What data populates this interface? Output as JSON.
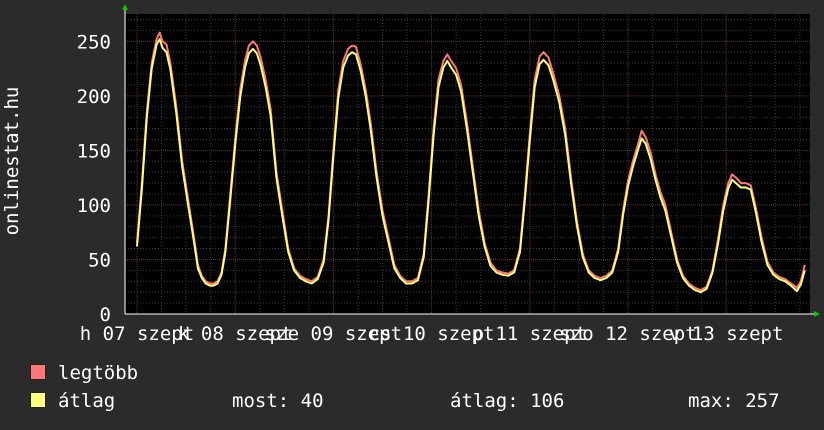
{
  "chart_data": {
    "type": "line",
    "ylabel": "onlinestat.hu",
    "ylim": [
      0,
      275
    ],
    "yticks": [
      0,
      50,
      100,
      150,
      200,
      250
    ],
    "xlim": [
      0,
      7.7
    ],
    "xticks": [
      {
        "x": 0.0,
        "label": "h 07 szept"
      },
      {
        "x": 1.0,
        "label": "k 08 szept"
      },
      {
        "x": 2.0,
        "label": "sze 09 szept"
      },
      {
        "x": 3.0,
        "label": "cs 10 szept"
      },
      {
        "x": 4.0,
        "label": "p 11 szept"
      },
      {
        "x": 5.0,
        "label": "szo 12 szept"
      },
      {
        "x": 6.0,
        "label": "v 13 szept"
      }
    ],
    "series": [
      {
        "name": "legtöbb",
        "color": "#ff7777",
        "points": [
          [
            0.0,
            65
          ],
          [
            0.05,
            120
          ],
          [
            0.1,
            185
          ],
          [
            0.15,
            230
          ],
          [
            0.2,
            252
          ],
          [
            0.23,
            258
          ],
          [
            0.26,
            250
          ],
          [
            0.3,
            247
          ],
          [
            0.34,
            230
          ],
          [
            0.4,
            190
          ],
          [
            0.46,
            140
          ],
          [
            0.52,
            105
          ],
          [
            0.58,
            70
          ],
          [
            0.62,
            45
          ],
          [
            0.66,
            35
          ],
          [
            0.7,
            30
          ],
          [
            0.74,
            28
          ],
          [
            0.78,
            28
          ],
          [
            0.82,
            30
          ],
          [
            0.86,
            38
          ],
          [
            0.9,
            60
          ],
          [
            0.95,
            110
          ],
          [
            1.0,
            160
          ],
          [
            1.05,
            205
          ],
          [
            1.1,
            232
          ],
          [
            1.14,
            246
          ],
          [
            1.18,
            250
          ],
          [
            1.22,
            246
          ],
          [
            1.26,
            235
          ],
          [
            1.31,
            215
          ],
          [
            1.36,
            188
          ],
          [
            1.42,
            130
          ],
          [
            1.48,
            95
          ],
          [
            1.54,
            60
          ],
          [
            1.6,
            42
          ],
          [
            1.66,
            35
          ],
          [
            1.72,
            32
          ],
          [
            1.78,
            30
          ],
          [
            1.84,
            34
          ],
          [
            1.9,
            50
          ],
          [
            1.95,
            90
          ],
          [
            2.0,
            150
          ],
          [
            2.05,
            205
          ],
          [
            2.1,
            232
          ],
          [
            2.15,
            243
          ],
          [
            2.19,
            246
          ],
          [
            2.23,
            245
          ],
          [
            2.28,
            228
          ],
          [
            2.33,
            205
          ],
          [
            2.38,
            175
          ],
          [
            2.44,
            130
          ],
          [
            2.5,
            95
          ],
          [
            2.56,
            70
          ],
          [
            2.62,
            45
          ],
          [
            2.68,
            35
          ],
          [
            2.74,
            30
          ],
          [
            2.8,
            30
          ],
          [
            2.86,
            33
          ],
          [
            2.92,
            55
          ],
          [
            2.97,
            110
          ],
          [
            3.02,
            170
          ],
          [
            3.07,
            215
          ],
          [
            3.12,
            232
          ],
          [
            3.16,
            238
          ],
          [
            3.2,
            232
          ],
          [
            3.25,
            225
          ],
          [
            3.3,
            210
          ],
          [
            3.36,
            175
          ],
          [
            3.42,
            135
          ],
          [
            3.48,
            95
          ],
          [
            3.54,
            65
          ],
          [
            3.6,
            47
          ],
          [
            3.66,
            40
          ],
          [
            3.72,
            38
          ],
          [
            3.78,
            37
          ],
          [
            3.84,
            40
          ],
          [
            3.9,
            60
          ],
          [
            3.95,
            110
          ],
          [
            4.0,
            165
          ],
          [
            4.05,
            215
          ],
          [
            4.1,
            236
          ],
          [
            4.14,
            240
          ],
          [
            4.19,
            235
          ],
          [
            4.24,
            220
          ],
          [
            4.3,
            200
          ],
          [
            4.36,
            170
          ],
          [
            4.42,
            125
          ],
          [
            4.48,
            85
          ],
          [
            4.54,
            55
          ],
          [
            4.6,
            40
          ],
          [
            4.66,
            35
          ],
          [
            4.72,
            33
          ],
          [
            4.78,
            35
          ],
          [
            4.84,
            40
          ],
          [
            4.9,
            60
          ],
          [
            4.95,
            95
          ],
          [
            5.0,
            122
          ],
          [
            5.05,
            140
          ],
          [
            5.1,
            155
          ],
          [
            5.14,
            168
          ],
          [
            5.18,
            162
          ],
          [
            5.23,
            148
          ],
          [
            5.28,
            128
          ],
          [
            5.33,
            112
          ],
          [
            5.38,
            100
          ],
          [
            5.44,
            75
          ],
          [
            5.5,
            50
          ],
          [
            5.56,
            35
          ],
          [
            5.62,
            28
          ],
          [
            5.68,
            24
          ],
          [
            5.74,
            22
          ],
          [
            5.8,
            25
          ],
          [
            5.86,
            40
          ],
          [
            5.92,
            70
          ],
          [
            5.97,
            100
          ],
          [
            6.02,
            120
          ],
          [
            6.06,
            128
          ],
          [
            6.1,
            125
          ],
          [
            6.15,
            120
          ],
          [
            6.2,
            120
          ],
          [
            6.25,
            118
          ],
          [
            6.3,
            98
          ],
          [
            6.36,
            70
          ],
          [
            6.42,
            48
          ],
          [
            6.48,
            38
          ],
          [
            6.54,
            34
          ],
          [
            6.6,
            32
          ],
          [
            6.66,
            28
          ],
          [
            6.72,
            24
          ],
          [
            6.76,
            30
          ],
          [
            6.8,
            45
          ]
        ]
      },
      {
        "name": "átlag",
        "color": "#ffff80",
        "points": [
          [
            0.0,
            62
          ],
          [
            0.05,
            115
          ],
          [
            0.1,
            180
          ],
          [
            0.15,
            225
          ],
          [
            0.2,
            247
          ],
          [
            0.23,
            252
          ],
          [
            0.26,
            244
          ],
          [
            0.3,
            240
          ],
          [
            0.34,
            224
          ],
          [
            0.4,
            184
          ],
          [
            0.46,
            135
          ],
          [
            0.52,
            100
          ],
          [
            0.58,
            66
          ],
          [
            0.62,
            42
          ],
          [
            0.66,
            33
          ],
          [
            0.7,
            28
          ],
          [
            0.74,
            26
          ],
          [
            0.78,
            26
          ],
          [
            0.82,
            28
          ],
          [
            0.86,
            36
          ],
          [
            0.9,
            57
          ],
          [
            0.95,
            105
          ],
          [
            1.0,
            155
          ],
          [
            1.05,
            198
          ],
          [
            1.1,
            226
          ],
          [
            1.14,
            239
          ],
          [
            1.18,
            243
          ],
          [
            1.22,
            239
          ],
          [
            1.26,
            228
          ],
          [
            1.31,
            208
          ],
          [
            1.36,
            182
          ],
          [
            1.42,
            125
          ],
          [
            1.48,
            90
          ],
          [
            1.54,
            57
          ],
          [
            1.6,
            40
          ],
          [
            1.66,
            33
          ],
          [
            1.72,
            30
          ],
          [
            1.78,
            28
          ],
          [
            1.84,
            32
          ],
          [
            1.9,
            47
          ],
          [
            1.95,
            86
          ],
          [
            2.0,
            145
          ],
          [
            2.05,
            198
          ],
          [
            2.1,
            226
          ],
          [
            2.15,
            237
          ],
          [
            2.19,
            240
          ],
          [
            2.23,
            238
          ],
          [
            2.28,
            222
          ],
          [
            2.33,
            199
          ],
          [
            2.38,
            169
          ],
          [
            2.44,
            125
          ],
          [
            2.5,
            90
          ],
          [
            2.56,
            66
          ],
          [
            2.62,
            42
          ],
          [
            2.68,
            33
          ],
          [
            2.74,
            28
          ],
          [
            2.8,
            28
          ],
          [
            2.86,
            31
          ],
          [
            2.92,
            52
          ],
          [
            2.97,
            105
          ],
          [
            3.02,
            164
          ],
          [
            3.07,
            208
          ],
          [
            3.12,
            226
          ],
          [
            3.16,
            232
          ],
          [
            3.2,
            226
          ],
          [
            3.25,
            219
          ],
          [
            3.3,
            204
          ],
          [
            3.36,
            169
          ],
          [
            3.42,
            130
          ],
          [
            3.48,
            90
          ],
          [
            3.54,
            62
          ],
          [
            3.6,
            44
          ],
          [
            3.66,
            38
          ],
          [
            3.72,
            36
          ],
          [
            3.78,
            35
          ],
          [
            3.84,
            38
          ],
          [
            3.9,
            57
          ],
          [
            3.95,
            105
          ],
          [
            4.0,
            159
          ],
          [
            4.05,
            208
          ],
          [
            4.1,
            229
          ],
          [
            4.14,
            233
          ],
          [
            4.19,
            228
          ],
          [
            4.24,
            214
          ],
          [
            4.3,
            194
          ],
          [
            4.36,
            164
          ],
          [
            4.42,
            120
          ],
          [
            4.48,
            81
          ],
          [
            4.54,
            52
          ],
          [
            4.6,
            38
          ],
          [
            4.66,
            33
          ],
          [
            4.72,
            31
          ],
          [
            4.78,
            33
          ],
          [
            4.84,
            38
          ],
          [
            4.9,
            57
          ],
          [
            4.95,
            91
          ],
          [
            5.0,
            117
          ],
          [
            5.05,
            135
          ],
          [
            5.1,
            150
          ],
          [
            5.14,
            161
          ],
          [
            5.18,
            156
          ],
          [
            5.23,
            142
          ],
          [
            5.28,
            123
          ],
          [
            5.33,
            107
          ],
          [
            5.38,
            95
          ],
          [
            5.44,
            71
          ],
          [
            5.5,
            47
          ],
          [
            5.56,
            33
          ],
          [
            5.62,
            26
          ],
          [
            5.68,
            22
          ],
          [
            5.74,
            20
          ],
          [
            5.8,
            23
          ],
          [
            5.86,
            38
          ],
          [
            5.92,
            66
          ],
          [
            5.97,
            95
          ],
          [
            6.02,
            115
          ],
          [
            6.06,
            123
          ],
          [
            6.1,
            120
          ],
          [
            6.15,
            116
          ],
          [
            6.2,
            116
          ],
          [
            6.25,
            114
          ],
          [
            6.3,
            94
          ],
          [
            6.36,
            66
          ],
          [
            6.42,
            45
          ],
          [
            6.48,
            36
          ],
          [
            6.54,
            32
          ],
          [
            6.6,
            30
          ],
          [
            6.66,
            26
          ],
          [
            6.72,
            21
          ],
          [
            6.76,
            27
          ],
          [
            6.8,
            40
          ]
        ]
      }
    ]
  },
  "legend": {
    "max_label": "legtöbb",
    "avg_label": "átlag",
    "most": "most: 40",
    "atlag": "átlag: 106",
    "max": "max: 257"
  },
  "colors": {
    "background": "#2b2b2b",
    "plot": "#000000",
    "grid_minor": "#3a3a3a",
    "grid_major": "#6a3030",
    "axis_arrow": "#00cc00"
  }
}
